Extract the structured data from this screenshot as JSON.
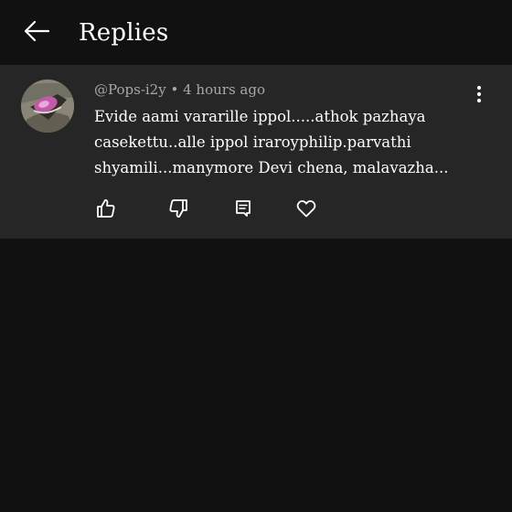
{
  "header": {
    "back_icon": "arrow-left-icon",
    "title": "Replies"
  },
  "comment": {
    "author": "@Pops-i2y",
    "separator": "•",
    "time": "4 hours ago",
    "text": "Evide aami vararille ippol.....athok pazhaya casekettu..alle ippol iraroyphilip.parvathi shyamili...manymore Devi chena, malavazha...",
    "actions": {
      "like_icon": "thumbs-up-icon",
      "dislike_icon": "thumbs-down-icon",
      "reply_icon": "comment-icon",
      "heart_icon": "heart-icon"
    },
    "more_icon": "more-vertical-icon"
  },
  "colors": {
    "background": "#111111",
    "card": "#262626",
    "text": "#ffffff",
    "meta": "#a8a8a8"
  }
}
